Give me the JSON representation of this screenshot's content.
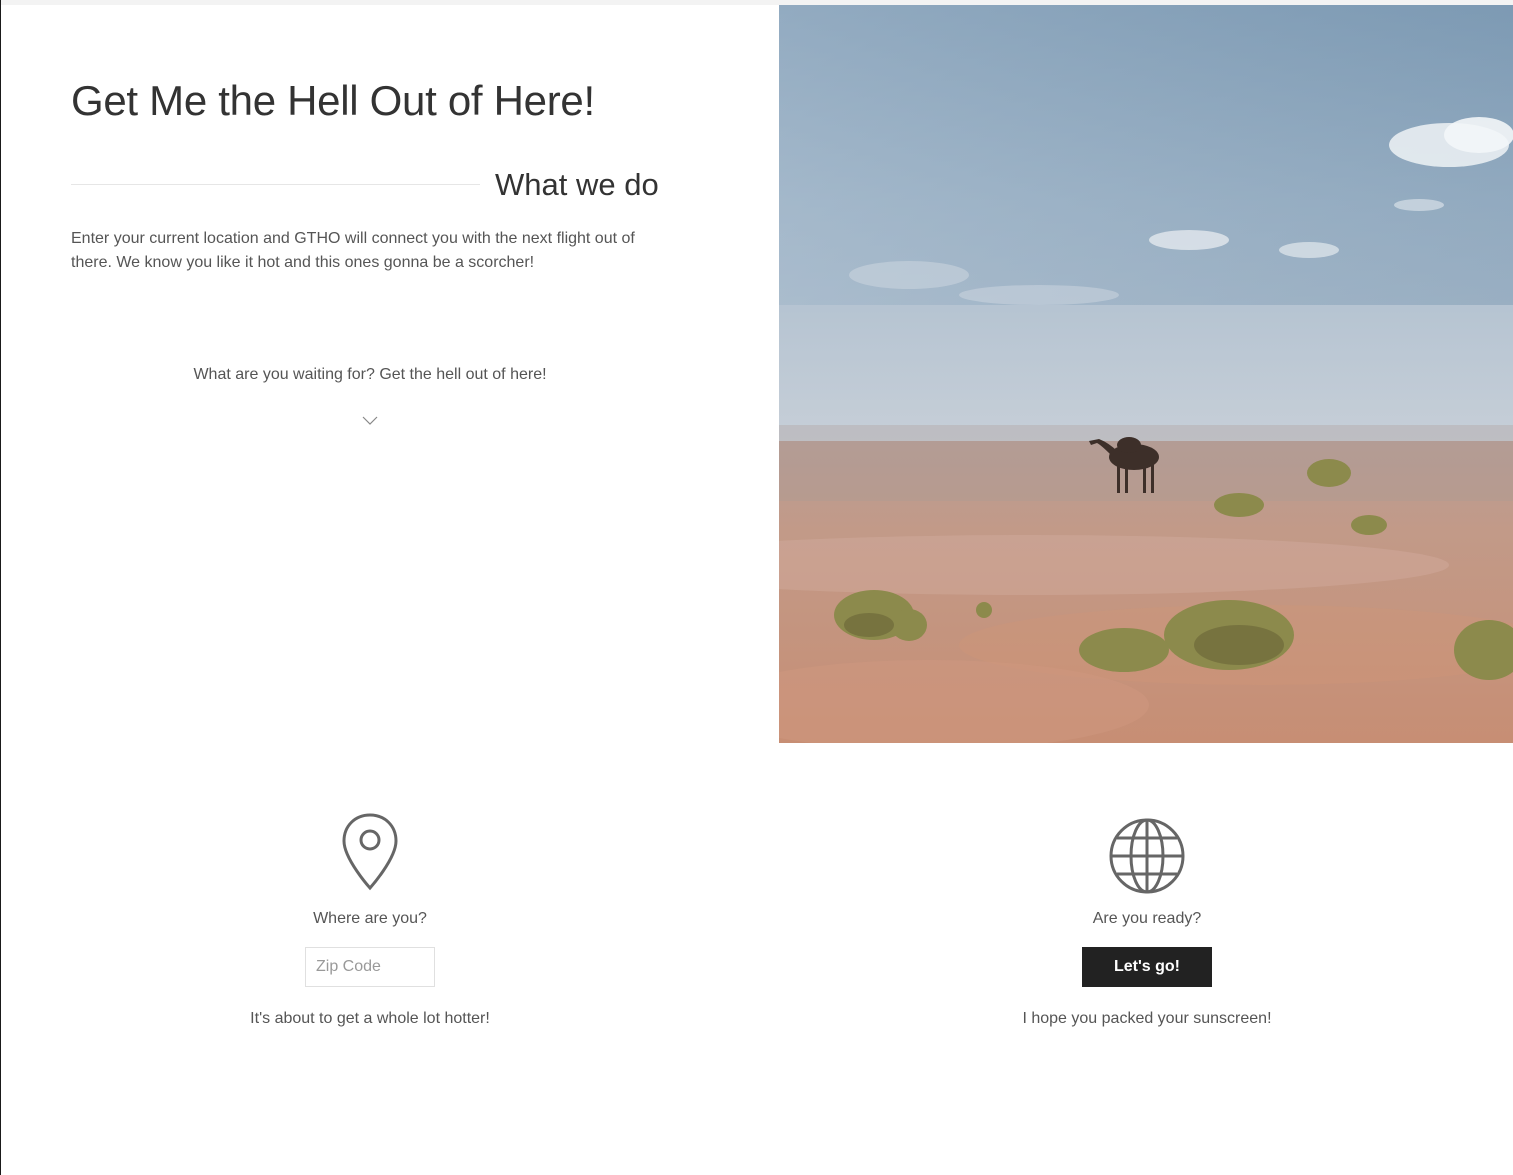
{
  "hero": {
    "title": "Get Me the Hell Out of Here!",
    "section_title": "What we do",
    "description": "Enter your current location and GTHO will connect you with the next flight out of there. We know you like it hot and this ones gonna be a scorcher!",
    "cta_text": "What are you waiting for? Get the hell out of here!",
    "scroll_icon": "chevron-down-icon",
    "image_icon": "desert-camel-photo"
  },
  "features": {
    "location": {
      "icon": "map-pin-icon",
      "label": "Where are you?",
      "input_placeholder": "Zip Code",
      "input_value": "",
      "subtext": "It's about to get a whole lot hotter!"
    },
    "ready": {
      "icon": "globe-icon",
      "label": "Are you ready?",
      "button_label": "Let's go!",
      "subtext": "I hope you packed your sunscreen!"
    }
  },
  "colors": {
    "text": "#555555",
    "heading": "#333333",
    "button_bg": "#222222",
    "button_text": "#ffffff"
  }
}
